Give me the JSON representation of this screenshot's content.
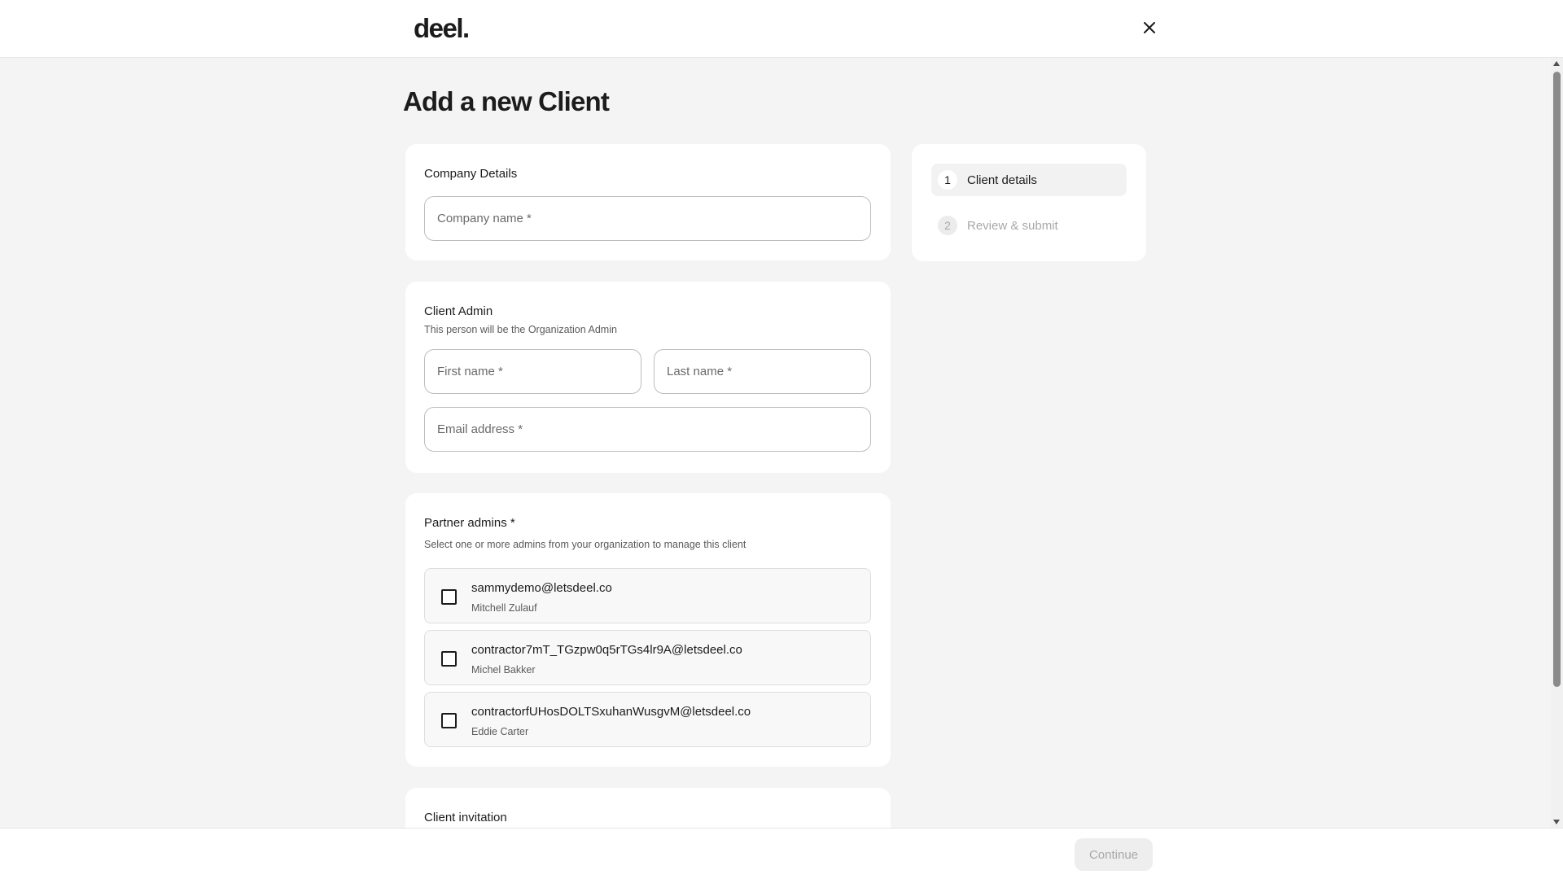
{
  "header": {
    "logo": "deel.",
    "close_icon": "close-icon"
  },
  "page": {
    "title": "Add a new Client"
  },
  "company_details": {
    "title": "Company Details",
    "company_name_placeholder": "Company name *"
  },
  "client_admin": {
    "title": "Client Admin",
    "subtitle": "This person will be the Organization Admin",
    "first_name_placeholder": "First name *",
    "last_name_placeholder": "Last name *",
    "email_placeholder": "Email address *"
  },
  "partner_admins": {
    "title": "Partner admins *",
    "subtitle": "Select one or more admins from your organization to manage this client",
    "admins": [
      {
        "email": "sammydemo@letsdeel.co",
        "name": "Mitchell Zulauf",
        "checked": false
      },
      {
        "email": "contractor7mT_TGzpw0q5rTGs4lr9A@letsdeel.co",
        "name": "Michel Bakker",
        "checked": false
      },
      {
        "email": "contractorfUHosDOLTSxuhanWusgvM@letsdeel.co",
        "name": "Eddie Carter",
        "checked": false
      }
    ]
  },
  "client_invitation": {
    "title": "Client invitation"
  },
  "steps": [
    {
      "number": "1",
      "label": "Client details",
      "active": true
    },
    {
      "number": "2",
      "label": "Review & submit",
      "active": false
    }
  ],
  "footer": {
    "continue_label": "Continue"
  }
}
